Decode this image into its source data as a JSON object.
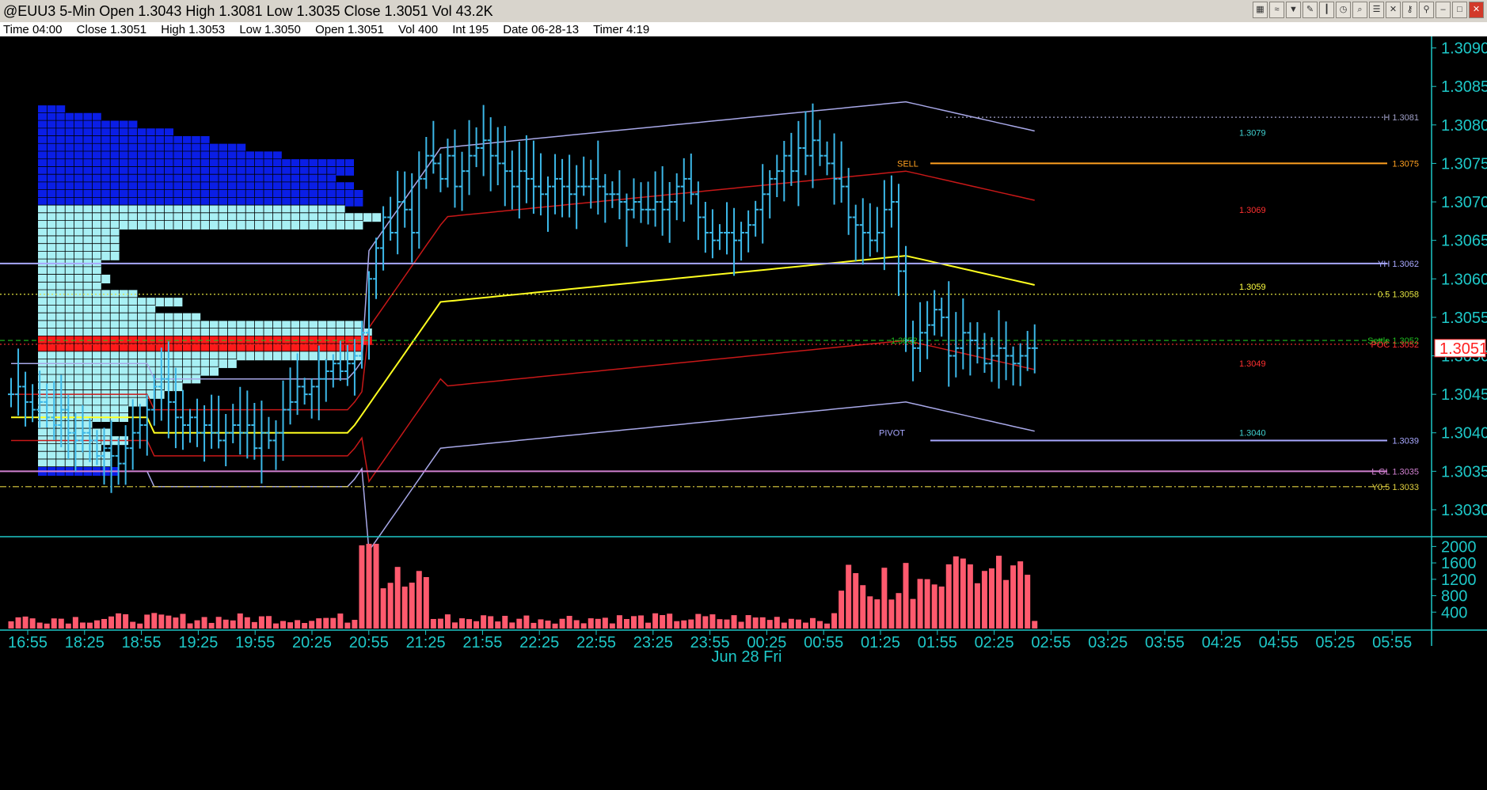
{
  "window": {
    "title": "@EUU3 5-Min Open 1.3043 High 1.3081 Low 1.3035 Close 1.3051 Vol 43.2K",
    "toolbar_icons": [
      "chart-style-icon",
      "overlay-icon",
      "indicator-icon",
      "pencil-icon",
      "bar-type-icon",
      "clock-icon",
      "zoom-icon",
      "properties-icon",
      "delete-icon",
      "lock-icon",
      "pin-icon",
      "minimize-icon",
      "maximize-icon",
      "close-icon"
    ]
  },
  "info": {
    "time": "Time 04:00",
    "close": "Close 1.3051",
    "high": "High 1.3053",
    "low": "Low 1.3050",
    "open": "Open 1.3051",
    "vol": "Vol 400",
    "int": "Int 195",
    "date": "Date 06-28-13",
    "timer": "Timer 4:19"
  },
  "chart_data": {
    "type": "candlestick",
    "symbol": "@EUU3",
    "interval": "5-Min",
    "ylim": [
      1.30265,
      1.30915
    ],
    "y_ticks": [
      1.303,
      1.3035,
      1.304,
      1.3045,
      1.305,
      1.3055,
      1.306,
      1.3065,
      1.307,
      1.3075,
      1.308,
      1.3085,
      1.309
    ],
    "y_tick_labels": [
      "1.3030",
      "1.3035",
      "1.3040",
      "1.3045",
      "1.3050",
      "1.3055",
      "1.3060",
      "1.3065",
      "1.3070",
      "1.3075",
      "1.3080",
      "1.3085",
      "1.3090"
    ],
    "last_price_label": "1.3051",
    "last_price": 1.3051,
    "x_tick_labels": [
      "16:55",
      "18:25",
      "18:55",
      "19:25",
      "19:55",
      "20:25",
      "20:55",
      "21:25",
      "21:55",
      "22:25",
      "22:55",
      "23:25",
      "23:55",
      "00:25",
      "00:55",
      "01:25",
      "01:55",
      "02:25",
      "02:55",
      "03:25",
      "03:55",
      "04:25",
      "04:55",
      "05:25",
      "05:55"
    ],
    "date_label": "Jun 28 Fri",
    "closes": [
      1.3045,
      1.3046,
      1.3044,
      1.3043,
      1.3044,
      1.3042,
      1.3041,
      1.3043,
      1.304,
      1.3039,
      1.304,
      1.3039,
      1.3037,
      1.3038,
      1.3037,
      1.3036,
      1.3038,
      1.304,
      1.3041,
      1.3043,
      1.3046,
      1.3047,
      1.3044,
      1.3042,
      1.3041,
      1.3042,
      1.304,
      1.3041,
      1.304,
      1.3039,
      1.304,
      1.3041,
      1.304,
      1.3041,
      1.3038,
      1.304,
      1.3039,
      1.304,
      1.3043,
      1.3044,
      1.3046,
      1.3045,
      1.3046,
      1.3047,
      1.3048,
      1.3049,
      1.3048,
      1.3049,
      1.305,
      1.3053,
      1.306,
      1.3064,
      1.3068,
      1.3066,
      1.307,
      1.3069,
      1.3066,
      1.3073,
      1.3076,
      1.3075,
      1.3073,
      1.3076,
      1.3072,
      1.3074,
      1.3076,
      1.3077,
      1.3078,
      1.3076,
      1.3075,
      1.3074,
      1.3072,
      1.3074,
      1.3073,
      1.3072,
      1.3071,
      1.3072,
      1.3073,
      1.3072,
      1.3071,
      1.3072,
      1.3072,
      1.3073,
      1.3072,
      1.3071,
      1.3071,
      1.307,
      1.3069,
      1.307,
      1.3069,
      1.3069,
      1.307,
      1.3069,
      1.307,
      1.3072,
      1.3073,
      1.3071,
      1.3068,
      1.3066,
      1.3065,
      1.3066,
      1.3066,
      1.3065,
      1.3066,
      1.3067,
      1.3069,
      1.3071,
      1.3073,
      1.3074,
      1.3076,
      1.3074,
      1.3077,
      1.3076,
      1.3078,
      1.3076,
      1.3075,
      1.3073,
      1.3072,
      1.3068,
      1.3067,
      1.3066,
      1.3065,
      1.3066,
      1.3069,
      1.307,
      1.3061,
      1.3052,
      1.3051,
      1.3053,
      1.3054,
      1.3056,
      1.3055,
      1.305,
      1.3051,
      1.3053,
      1.3052,
      1.3051,
      1.3049,
      1.305,
      1.3051,
      1.305,
      1.3049,
      1.305,
      1.3051,
      1.3051
    ],
    "volume": {
      "ylim": [
        0,
        2200
      ],
      "y_ticks": [
        400,
        800,
        1200,
        1600,
        2000
      ],
      "y_tick_labels": [
        "400",
        "800",
        "1200",
        "1600",
        "2000"
      ]
    },
    "levels": [
      {
        "label": "H 1.3081",
        "value": 1.3081,
        "color": "#a0a0c8",
        "style": "dotted"
      },
      {
        "label": "1.3075",
        "value": 1.3075,
        "color": "#ffa020",
        "style": "solid"
      },
      {
        "label": "YH 1.3062",
        "value": 1.3062,
        "color": "#a8a8ff",
        "style": "solid"
      },
      {
        "label": "0.5 1.3058",
        "value": 1.3058,
        "color": "#e0e040",
        "style": "dotted"
      },
      {
        "label": "Settle 1.3052",
        "value": 1.3052,
        "color": "#20c020",
        "style": "dashed"
      },
      {
        "label": "POC 1.3052",
        "value": 1.30515,
        "color": "#ff3030",
        "style": "dotted"
      },
      {
        "label": "1.3039",
        "value": 1.3039,
        "color": "#a8a8ff",
        "style": "solid"
      },
      {
        "label": "L GL 1.3035",
        "value": 1.3035,
        "color": "#d080d0",
        "style": "solid"
      },
      {
        "label": "Y0.5 1.3033",
        "value": 1.3033,
        "color": "#e0d040",
        "style": "dashdot"
      }
    ],
    "annotations": [
      {
        "text": "SELL",
        "value": 1.3075,
        "color": "#ffa020"
      },
      {
        "text": "PIVOT",
        "value": 1.304,
        "color": "#a8a8ff"
      },
      {
        "text": "1.3052",
        "value": 1.3052,
        "color": "#20c020"
      }
    ],
    "band_end_labels": [
      {
        "text": "1.3079",
        "value": 1.3079,
        "color": "#40d0d0"
      },
      {
        "text": "1.3069",
        "value": 1.3069,
        "color": "#ff3030"
      },
      {
        "text": "1.3059",
        "value": 1.3059,
        "color": "#ffff40"
      },
      {
        "text": "1.3049",
        "value": 1.3049,
        "color": "#ff3030"
      },
      {
        "text": "1.3040",
        "value": 1.304,
        "color": "#40d0d0"
      }
    ],
    "colors": {
      "bars": "#3cb8e8",
      "volume": "#ff5a6e",
      "profile_upper": "#0a1ee6",
      "profile_main": "#a8f0f4",
      "poc": "#ff1a1a",
      "axis": "#1ec8c8",
      "vwap": "#ffff20",
      "band1": "#c81818",
      "band2": "#a8a8e8"
    }
  }
}
